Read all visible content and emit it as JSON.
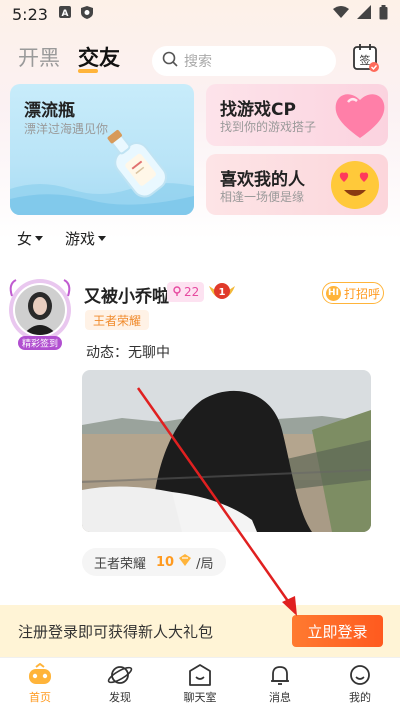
{
  "status_bar": {
    "time": "5:23"
  },
  "header": {
    "tabs": [
      {
        "label": "开黑",
        "active": false
      },
      {
        "label": "交友",
        "active": true
      }
    ],
    "search_placeholder": "搜索",
    "signin_label": "签"
  },
  "cards": {
    "bottle": {
      "title": "漂流瓶",
      "subtitle": "漂洋过海遇见你"
    },
    "cp": {
      "title": "找游戏CP",
      "subtitle": "找到你的游戏搭子"
    },
    "like": {
      "title": "喜欢我的人",
      "subtitle": "相逢一场便是缘"
    }
  },
  "filters": [
    {
      "label": "女"
    },
    {
      "label": "游戏"
    }
  ],
  "post": {
    "username": "又被小乔啦",
    "avatar_badge": "精彩签到",
    "level": "22",
    "rank": "1",
    "greet_label": "打招呼",
    "greet_icon_text": "HI",
    "game_tag": "王者荣耀",
    "status": "动态：无聊中",
    "game_info": {
      "game": "王者荣耀",
      "price": "10",
      "unit": "/局"
    }
  },
  "register_bar": {
    "text": "注册登录即可获得新人大礼包",
    "button": "立即登录"
  },
  "tabbar": [
    {
      "label": "首页",
      "icon": "home-game-icon",
      "active": true
    },
    {
      "label": "发现",
      "icon": "planet-icon",
      "active": false
    },
    {
      "label": "聊天室",
      "icon": "chatroom-icon",
      "active": false
    },
    {
      "label": "消息",
      "icon": "bell-icon",
      "active": false
    },
    {
      "label": "我的",
      "icon": "profile-icon",
      "active": false
    }
  ],
  "colors": {
    "accent": "#ff9a1f",
    "login_button": "#ff5a1f",
    "annotation_arrow": "#e02020"
  }
}
